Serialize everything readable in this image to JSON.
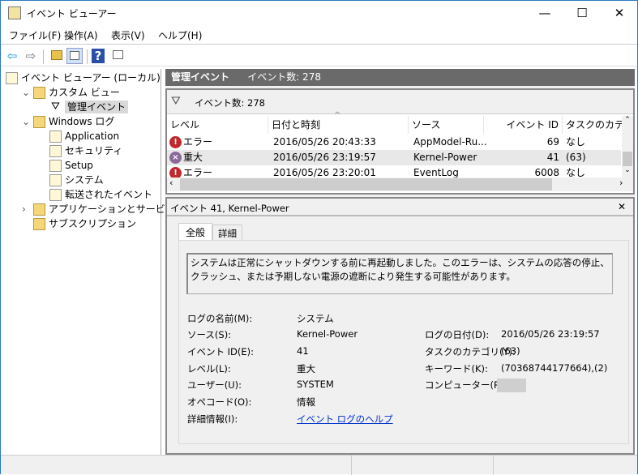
{
  "window": {
    "title": "イベント ビューアー",
    "minimize": "—",
    "maximize": "☐",
    "close": "✕"
  },
  "menu": [
    "ファイル(F)",
    "操作(A)",
    "表示(V)",
    "ヘルプ(H)"
  ],
  "toolbar": {
    "back": "⇦",
    "forward": "⇨",
    "help": "?"
  },
  "tree": [
    {
      "label": "イベント ビューアー (ローカル)",
      "indent": 0,
      "expander": ""
    },
    {
      "label": "カスタム ビュー",
      "indent": 1,
      "expander": "⌄"
    },
    {
      "label": "管理イベント",
      "indent": 2,
      "expander": "",
      "selected": true
    },
    {
      "label": "Windows ログ",
      "indent": 1,
      "expander": "⌄"
    },
    {
      "label": "Application",
      "indent": 2,
      "expander": ""
    },
    {
      "label": "セキュリティ",
      "indent": 2,
      "expander": ""
    },
    {
      "label": "Setup",
      "indent": 2,
      "expander": ""
    },
    {
      "label": "システム",
      "indent": 2,
      "expander": ""
    },
    {
      "label": "転送されたイベント",
      "indent": 2,
      "expander": ""
    },
    {
      "label": "アプリケーションとサービス ログ",
      "indent": 1,
      "expander": "›"
    },
    {
      "label": "サブスクリプション",
      "indent": 1,
      "expander": ""
    }
  ],
  "header": {
    "title": "管理イベント",
    "count": "イベント数: 278"
  },
  "filter": {
    "count": "イベント数: 278"
  },
  "columns": [
    "レベル",
    "日付と時刻",
    "ソース",
    "イベント ID",
    "タスクのカテゴ"
  ],
  "rows": [
    {
      "level": "エラー",
      "type": "error",
      "date": "2016/05/26 20:43:33",
      "source": "AppModel-Ru...",
      "id": "69",
      "task": "なし"
    },
    {
      "level": "重大",
      "type": "critical",
      "date": "2016/05/26 23:19:57",
      "source": "Kernel-Power",
      "id": "41",
      "task": "(63)"
    },
    {
      "level": "エラー",
      "type": "error",
      "date": "2016/05/26 23:20:01",
      "source": "EventLog",
      "id": "6008",
      "task": "なし"
    }
  ],
  "detail": {
    "title": "イベント 41, Kernel-Power",
    "close": "✕",
    "tabs": [
      "全般",
      "詳細"
    ],
    "description": "システムは正常にシャットダウンする前に再起動しました。このエラーは、システムの応答の停止、クラッシュ、または予期しない電源の遮断により発生する可能性があります。",
    "fields": {
      "log_name_label": "ログの名前(M):",
      "log_name": "システム",
      "source_label": "ソース(S):",
      "source": "Kernel-Power",
      "event_id_label": "イベント ID(E):",
      "event_id": "41",
      "level_label": "レベル(L):",
      "level": "重大",
      "user_label": "ユーザー(U):",
      "user": "SYSTEM",
      "opcode_label": "オペコード(O):",
      "opcode": "情報",
      "more_label": "詳細情報(I):",
      "more_link": "イベント ログのヘルプ",
      "logged_label": "ログの日付(D):",
      "logged": "2016/05/26 23:19:57",
      "task_label": "タスクのカテゴリ(Y):",
      "task": "(63)",
      "keywords_label": "キーワード(K):",
      "keywords": "(70368744177664),(2)",
      "computer_label": "コンピューター(R):"
    }
  },
  "colors": {
    "header": "#6a6a6a",
    "error": "#c0282d",
    "critical": "#8a6a9a",
    "link": "#0033cc"
  }
}
